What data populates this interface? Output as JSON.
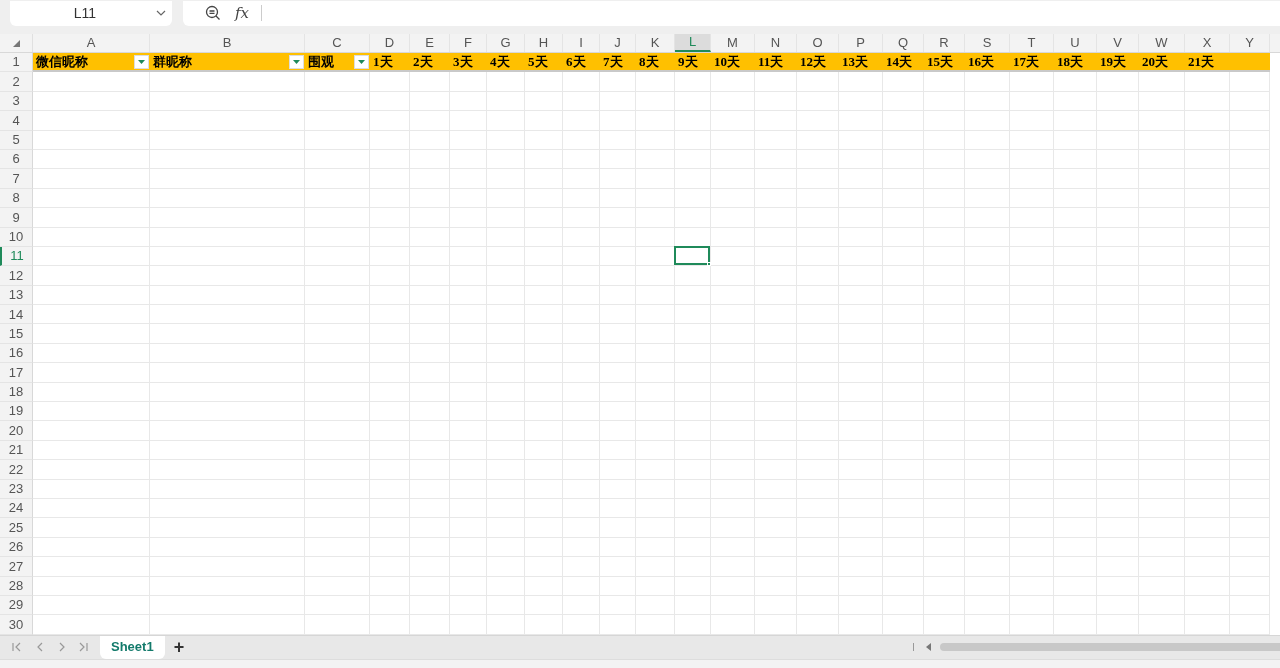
{
  "name_box": {
    "value": "L11"
  },
  "formula_bar": {
    "fx_label": "fx"
  },
  "columns": [
    {
      "letter": "A",
      "selected": false
    },
    {
      "letter": "B",
      "selected": false
    },
    {
      "letter": "C",
      "selected": false
    },
    {
      "letter": "D",
      "selected": false
    },
    {
      "letter": "E",
      "selected": false
    },
    {
      "letter": "F",
      "selected": false
    },
    {
      "letter": "G",
      "selected": false
    },
    {
      "letter": "H",
      "selected": false
    },
    {
      "letter": "I",
      "selected": false
    },
    {
      "letter": "J",
      "selected": false
    },
    {
      "letter": "K",
      "selected": false
    },
    {
      "letter": "L",
      "selected": true
    },
    {
      "letter": "M",
      "selected": false
    },
    {
      "letter": "N",
      "selected": false
    },
    {
      "letter": "O",
      "selected": false
    },
    {
      "letter": "P",
      "selected": false
    },
    {
      "letter": "Q",
      "selected": false
    },
    {
      "letter": "R",
      "selected": false
    },
    {
      "letter": "S",
      "selected": false
    },
    {
      "letter": "T",
      "selected": false
    },
    {
      "letter": "U",
      "selected": false
    },
    {
      "letter": "V",
      "selected": false
    },
    {
      "letter": "W",
      "selected": false
    },
    {
      "letter": "X",
      "selected": false
    },
    {
      "letter": "Y",
      "selected": false
    }
  ],
  "header_row": [
    {
      "text": "微信昵称",
      "filter": true
    },
    {
      "text": "群昵称",
      "filter": true
    },
    {
      "text": "围观",
      "filter": true
    },
    {
      "text": "1天",
      "filter": false
    },
    {
      "text": "2天",
      "filter": false
    },
    {
      "text": "3天",
      "filter": false
    },
    {
      "text": "4天",
      "filter": false
    },
    {
      "text": "5天",
      "filter": false
    },
    {
      "text": "6天",
      "filter": false
    },
    {
      "text": "7天",
      "filter": false
    },
    {
      "text": "8天",
      "filter": false
    },
    {
      "text": "9天",
      "filter": false
    },
    {
      "text": "10天",
      "filter": false
    },
    {
      "text": "11天",
      "filter": false
    },
    {
      "text": "12天",
      "filter": false
    },
    {
      "text": "13天",
      "filter": false
    },
    {
      "text": "14天",
      "filter": false
    },
    {
      "text": "15天",
      "filter": false
    },
    {
      "text": "16天",
      "filter": false
    },
    {
      "text": "17天",
      "filter": false
    },
    {
      "text": "18天",
      "filter": false
    },
    {
      "text": "19天",
      "filter": false
    },
    {
      "text": "20天",
      "filter": false
    },
    {
      "text": "21天",
      "filter": false
    }
  ],
  "rows": [
    {
      "number": "1",
      "selected": false
    },
    {
      "number": "2",
      "selected": false
    },
    {
      "number": "3",
      "selected": false
    },
    {
      "number": "4",
      "selected": false
    },
    {
      "number": "5",
      "selected": false
    },
    {
      "number": "6",
      "selected": false
    },
    {
      "number": "7",
      "selected": false
    },
    {
      "number": "8",
      "selected": false
    },
    {
      "number": "9",
      "selected": false
    },
    {
      "number": "10",
      "selected": false
    },
    {
      "number": "11",
      "selected": true
    },
    {
      "number": "12",
      "selected": false
    },
    {
      "number": "13",
      "selected": false
    },
    {
      "number": "14",
      "selected": false
    },
    {
      "number": "15",
      "selected": false
    },
    {
      "number": "16",
      "selected": false
    },
    {
      "number": "17",
      "selected": false
    },
    {
      "number": "18",
      "selected": false
    },
    {
      "number": "19",
      "selected": false
    },
    {
      "number": "20",
      "selected": false
    },
    {
      "number": "21",
      "selected": false
    },
    {
      "number": "22",
      "selected": false
    },
    {
      "number": "23",
      "selected": false
    },
    {
      "number": "24",
      "selected": false
    },
    {
      "number": "25",
      "selected": false
    },
    {
      "number": "26",
      "selected": false
    },
    {
      "number": "27",
      "selected": false
    },
    {
      "number": "28",
      "selected": false
    },
    {
      "number": "29",
      "selected": false
    },
    {
      "number": "30",
      "selected": false
    }
  ],
  "sheet_tabs": [
    {
      "label": "Sheet1",
      "selected": true
    }
  ],
  "add_sheet": "+"
}
